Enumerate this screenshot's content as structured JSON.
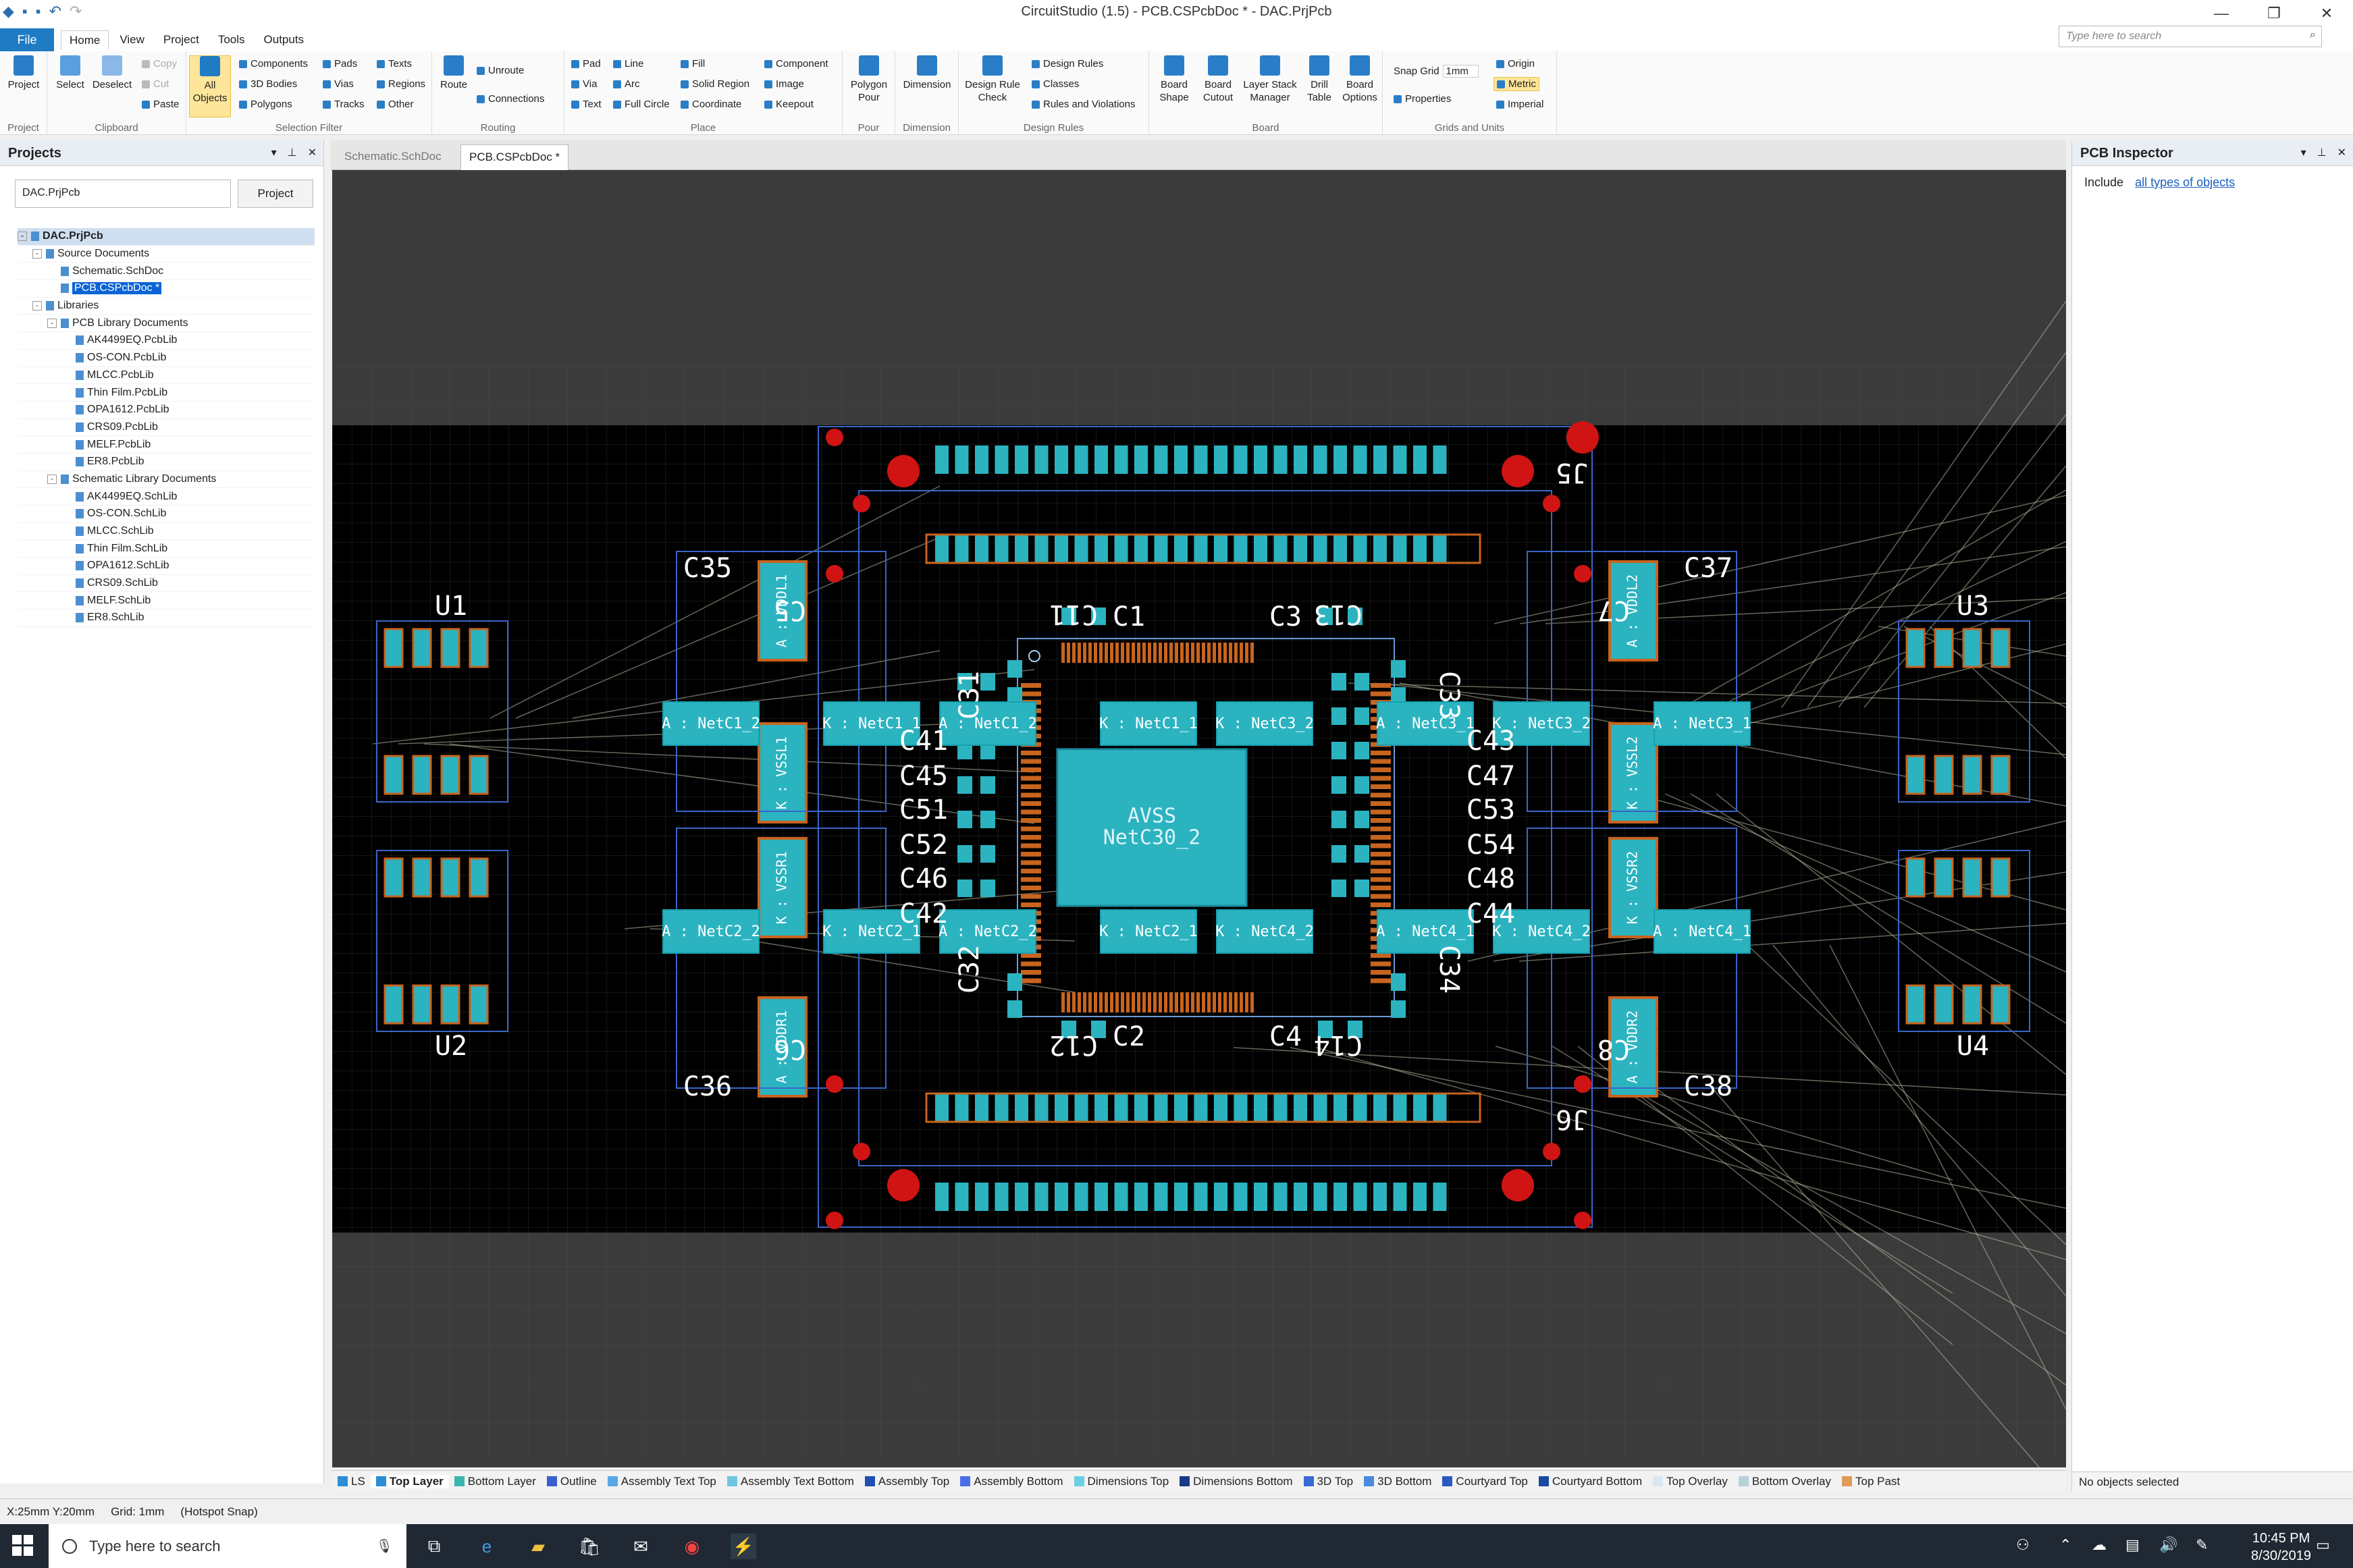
{
  "window": {
    "title": "CircuitStudio (1.5) - PCB.CSPcbDoc * - DAC.PrjPcb"
  },
  "menu": {
    "file_label": "File",
    "tabs": [
      "Home",
      "View",
      "Project",
      "Tools",
      "Outputs"
    ]
  },
  "search": {
    "placeholder": "Type here to search"
  },
  "ribbon": {
    "project": {
      "label": "Project",
      "group": "Project"
    },
    "clipboard": {
      "select": "Select",
      "deselect": "Deselect",
      "copy": "Copy",
      "cut": "Cut",
      "paste": "Paste",
      "group": "Clipboard"
    },
    "selection_filter": {
      "all_objects": [
        "All",
        "Objects"
      ],
      "items": [
        "Components",
        "3D Bodies",
        "Polygons",
        "Pads",
        "Vias",
        "Tracks",
        "Texts",
        "Regions",
        "Other"
      ],
      "group": "Selection Filter"
    },
    "routing": {
      "route": "Route",
      "unroute": "Unroute",
      "connections": "Connections",
      "group": "Routing"
    },
    "place": {
      "items": [
        "Pad",
        "Via",
        "Text",
        "Line",
        "Arc",
        "Full Circle",
        "Fill",
        "Solid Region",
        "Coordinate",
        "Component",
        "Image",
        "Keepout"
      ],
      "group": "Place"
    },
    "pour": {
      "polygon": [
        "Polygon",
        "Pour"
      ],
      "group": "Pour"
    },
    "dimension": {
      "label": "Dimension",
      "group": "Dimension"
    },
    "design_rules": {
      "check": [
        "Design Rule",
        "Check"
      ],
      "items": [
        "Design Rules",
        "Classes",
        "Rules and Violations"
      ],
      "group": "Design Rules"
    },
    "board": {
      "items": [
        [
          "Board",
          "Shape"
        ],
        [
          "Board",
          "Cutout"
        ],
        [
          "Layer Stack",
          "Manager"
        ],
        [
          "Drill",
          "Table"
        ],
        [
          "Board",
          "Options"
        ]
      ],
      "group": "Board"
    },
    "grids": {
      "snap_label": "Snap Grid",
      "snap_value": "1mm",
      "properties": "Properties",
      "origin": "Origin",
      "metric": "Metric",
      "imperial": "Imperial",
      "group": "Grids and Units"
    }
  },
  "projects_panel": {
    "title": "Projects",
    "search_value": "DAC.PrjPcb",
    "button": "Project",
    "tree": [
      {
        "label": "DAC.PrjPcb",
        "level": 0,
        "expander": "-",
        "bold": true
      },
      {
        "label": "Source Documents",
        "level": 1,
        "expander": "-"
      },
      {
        "label": "Schematic.SchDoc",
        "level": 2
      },
      {
        "label": "PCB.CSPcbDoc *",
        "level": 2,
        "selected": true
      },
      {
        "label": "Libraries",
        "level": 1,
        "expander": "-"
      },
      {
        "label": "PCB Library Documents",
        "level": 2,
        "expander": "-"
      },
      {
        "label": "AK4499EQ.PcbLib",
        "level": 3
      },
      {
        "label": "OS-CON.PcbLib",
        "level": 3
      },
      {
        "label": "MLCC.PcbLib",
        "level": 3
      },
      {
        "label": "Thin Film.PcbLib",
        "level": 3
      },
      {
        "label": "OPA1612.PcbLib",
        "level": 3
      },
      {
        "label": "CRS09.PcbLib",
        "level": 3
      },
      {
        "label": "MELF.PcbLib",
        "level": 3
      },
      {
        "label": "ER8.PcbLib",
        "level": 3
      },
      {
        "label": "Schematic Library Documents",
        "level": 2,
        "expander": "-"
      },
      {
        "label": "AK4499EQ.SchLib",
        "level": 3
      },
      {
        "label": "OS-CON.SchLib",
        "level": 3
      },
      {
        "label": "MLCC.SchLib",
        "level": 3
      },
      {
        "label": "Thin Film.SchLib",
        "level": 3
      },
      {
        "label": "OPA1612.SchLib",
        "level": 3
      },
      {
        "label": "CRS09.SchLib",
        "level": 3
      },
      {
        "label": "MELF.SchLib",
        "level": 3
      },
      {
        "label": "ER8.SchLib",
        "level": 3
      }
    ]
  },
  "doc_tabs": [
    "Schematic.SchDoc",
    "PCB.CSPcbDoc *"
  ],
  "pcb": {
    "designators": [
      "U1",
      "U2",
      "U3",
      "U4",
      "C35",
      "C36",
      "C37",
      "C38",
      "C1",
      "C2",
      "C3",
      "C4",
      "C31",
      "C32",
      "C33",
      "C34",
      "C41",
      "C45",
      "C51",
      "C52",
      "C46",
      "C42",
      "C43",
      "C47",
      "C53",
      "C54",
      "C48",
      "C44",
      "J5",
      "J6",
      "C11",
      "C12",
      "C13",
      "C14",
      "C5",
      "C6",
      "C7",
      "C8"
    ],
    "pad_labels": [
      "A : NetC1_2",
      "K : NetC1_1",
      "A : NetC1_2",
      "K : NetC1_1",
      "K : NetC3_2",
      "A : NetC3_1",
      "K : NetC3_2",
      "A : NetC3_1",
      "A : NetC2_2",
      "K : NetC2_1",
      "A : NetC2_2",
      "K : NetC2_1",
      "K : NetC4_2",
      "A : NetC4_1",
      "K : NetC4_2",
      "A : NetC4_1"
    ],
    "vertical_labels": [
      "A : VDDL1",
      "K : VSSL1",
      "K : VSSR1",
      "A : VDDR1",
      "A : VDDL2",
      "K : VSSL2",
      "K : VSSR2",
      "A : VDDR2"
    ],
    "center_pad": [
      "AVSS",
      "NetC30_2"
    ],
    "colors": {
      "board": "#000000",
      "pad": "#2bb3c0",
      "copper": "#c8641e",
      "drill": "#d01414",
      "outline": "#3a66c8",
      "text": "#ffffff"
    }
  },
  "layer_tabs": [
    {
      "label": "LS",
      "color": "#2b8ed6"
    },
    {
      "label": "Top Layer",
      "color": "#2b8ed6",
      "active": true
    },
    {
      "label": "Bottom Layer",
      "color": "#3bb5b0"
    },
    {
      "label": "Outline",
      "color": "#3a5fd0"
    },
    {
      "label": "Assembly Text Top",
      "color": "#5aa7e6"
    },
    {
      "label": "Assembly Text Bottom",
      "color": "#6fc6e0"
    },
    {
      "label": "Assembly Top",
      "color": "#1f4fb0"
    },
    {
      "label": "Assembly Bottom",
      "color": "#4a6ee8"
    },
    {
      "label": "Dimensions Top",
      "color": "#6ad0e8"
    },
    {
      "label": "Dimensions Bottom",
      "color": "#1a3a8a"
    },
    {
      "label": "3D Top",
      "color": "#3a6ad8"
    },
    {
      "label": "3D Bottom",
      "color": "#4a8ae0"
    },
    {
      "label": "Courtyard Top",
      "color": "#2a5ac0"
    },
    {
      "label": "Courtyard Bottom",
      "color": "#1a4aa0"
    },
    {
      "label": "Top Overlay",
      "color": "#d8e8f0"
    },
    {
      "label": "Bottom Overlay",
      "color": "#b8d0d8"
    },
    {
      "label": "Top Past",
      "color": "#e09a5a"
    }
  ],
  "inspector": {
    "title": "PCB Inspector",
    "include_label": "Include",
    "include_link": "all types of objects",
    "footer": "No objects selected"
  },
  "status": {
    "coords": "X:25mm Y:20mm",
    "grid": "Grid: 1mm",
    "snap": "(Hotspot Snap)"
  },
  "taskbar": {
    "search": "Type here to search",
    "time": "10:45 PM",
    "date": "8/30/2019"
  }
}
